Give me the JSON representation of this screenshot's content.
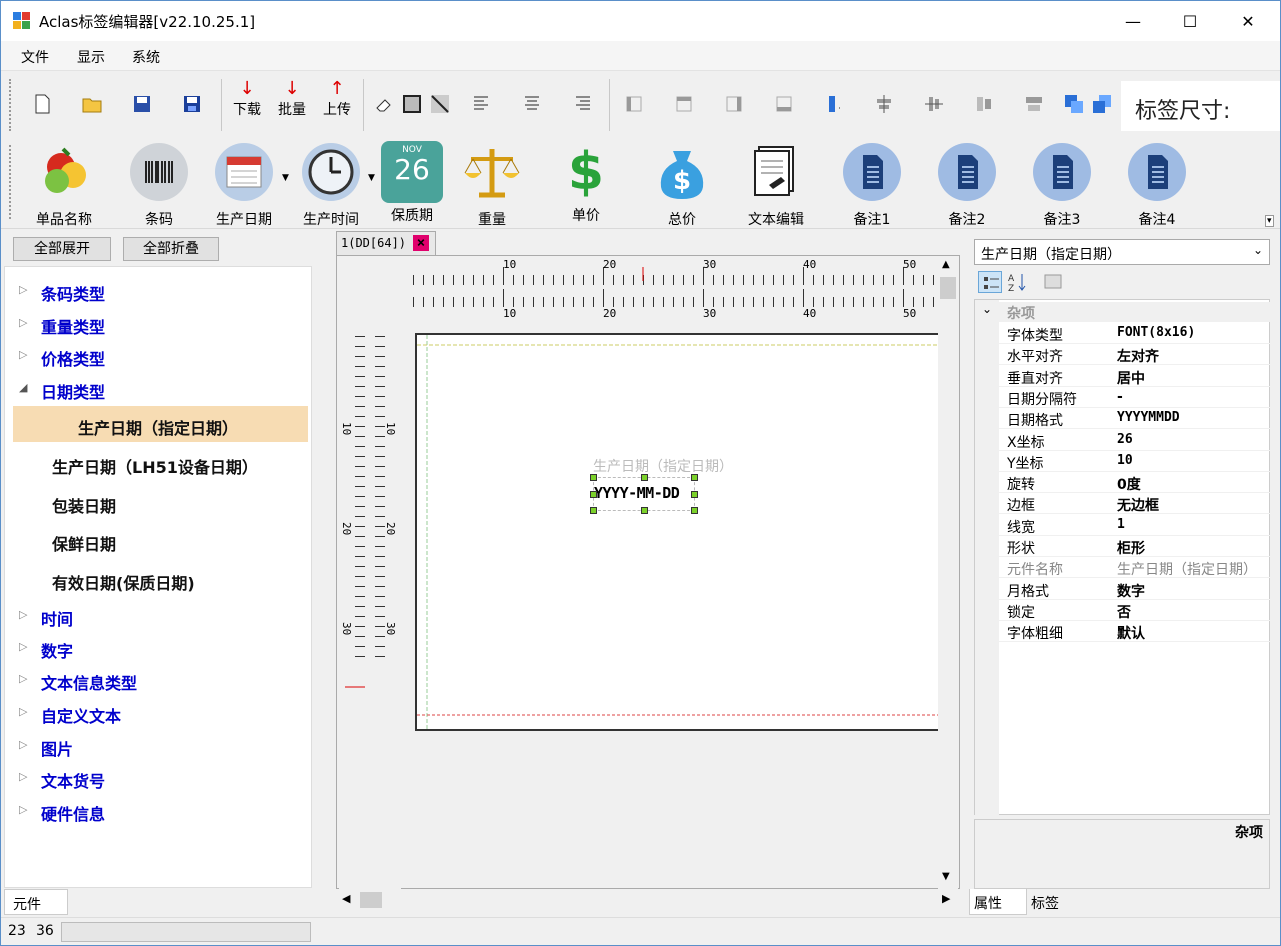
{
  "window": {
    "title": "Aclas标签编辑器[v22.10.25.1]",
    "minimize": "—",
    "maximize": "☐",
    "close": "✕"
  },
  "menu": [
    "文件",
    "显示",
    "系统"
  ],
  "toolbar": {
    "download": "下载",
    "batch": "批量",
    "upload": "上传",
    "size_label": "标签尺寸:"
  },
  "components": [
    "单品名称",
    "条码",
    "生产日期",
    "生产时间",
    "保质期",
    "重量",
    "单价",
    "总价",
    "文本编辑",
    "备注1",
    "备注2",
    "备注3",
    "备注4"
  ],
  "calendar": {
    "month": "NOV",
    "day": "26"
  },
  "left": {
    "expand_all": "全部展开",
    "collapse_all": "全部折叠"
  },
  "tree": {
    "cats_top": [
      "条码类型",
      "重量类型",
      "价格类型"
    ],
    "date_cat": "日期类型",
    "date_items": [
      "生产日期（指定日期）",
      "生产日期（LH51设备日期）",
      "包装日期",
      "保鲜日期",
      "有效日期(保质日期)"
    ],
    "cats_bottom": [
      "时间",
      "数字",
      "文本信息类型",
      "自定义文本",
      "图片",
      "文本货号",
      "硬件信息"
    ]
  },
  "bottom_tab": "元件",
  "status": {
    "x": "23",
    "y": "36"
  },
  "doc_tab": {
    "label": "1(DD[64])",
    "close": "×"
  },
  "ruler": {
    "h_ticks": [
      "10",
      "20",
      "30",
      "40",
      "50"
    ],
    "v_ticks": [
      "10",
      "20",
      "30"
    ]
  },
  "element": {
    "caption": "生产日期（指定日期）",
    "text": "YYYY-MM-DD"
  },
  "props": {
    "combo": "生产日期（指定日期）",
    "category": "杂项",
    "rows": [
      {
        "k": "字体类型",
        "v": "FONT(8x16)"
      },
      {
        "k": "水平对齐",
        "v": "左对齐"
      },
      {
        "k": "垂直对齐",
        "v": "居中"
      },
      {
        "k": "日期分隔符",
        "v": "-"
      },
      {
        "k": "日期格式",
        "v": "YYYYMMDD"
      },
      {
        "k": "X坐标",
        "v": "26"
      },
      {
        "k": "Y坐标",
        "v": "10"
      },
      {
        "k": "旋转",
        "v": "0度"
      },
      {
        "k": "边框",
        "v": "无边框"
      },
      {
        "k": "线宽",
        "v": "1"
      },
      {
        "k": "形状",
        "v": "柜形"
      },
      {
        "k": "元件名称",
        "v": "生产日期（指定日期）"
      },
      {
        "k": "月格式",
        "v": "数字"
      },
      {
        "k": "锁定",
        "v": "否"
      },
      {
        "k": "字体粗细",
        "v": "默认"
      }
    ],
    "desc_title": "杂项",
    "tabs": [
      "属性",
      "标签"
    ]
  }
}
